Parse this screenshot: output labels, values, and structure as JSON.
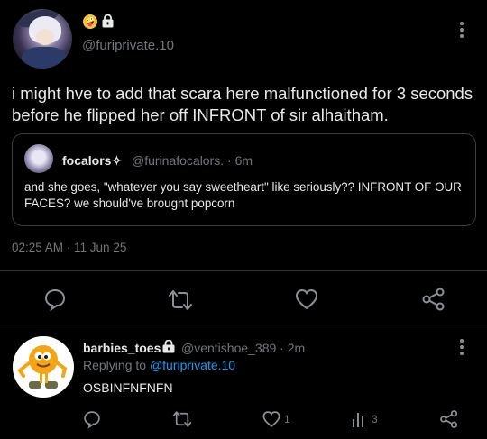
{
  "main_tweet": {
    "handle": "@furiprivate.10",
    "header_emoji": "🤪",
    "text": "i might hve to add that scara here malfunctioned for 3 seconds before he flipped her off INFRONT of sir alhaitham.",
    "timestamp": "02:25 AM · 11 Jun 25"
  },
  "quote": {
    "name": "focalors✧",
    "handle_time": "@furinafocalors. · 6m",
    "text": "and she goes, \"whatever you say sweetheart\" like seriously?? INFRONT OF OUR FACES? we should've brought popcorn"
  },
  "actions": {
    "icons": [
      "reply-icon",
      "retweet-icon",
      "like-icon",
      "share-icon"
    ]
  },
  "reply": {
    "name": "barbies_toes",
    "handle_time": "@ventishoe_389 · 2m",
    "replying_prefix": "Replying to",
    "replying_handle": "@furiprivate.10",
    "text": "OSBINFNFNFN",
    "likes": "1",
    "views": "3"
  },
  "colors": {
    "background": "#000000",
    "text": "#e7e9ea",
    "muted": "#71767b",
    "link": "#1d9bf0",
    "border": "#2f3336"
  }
}
